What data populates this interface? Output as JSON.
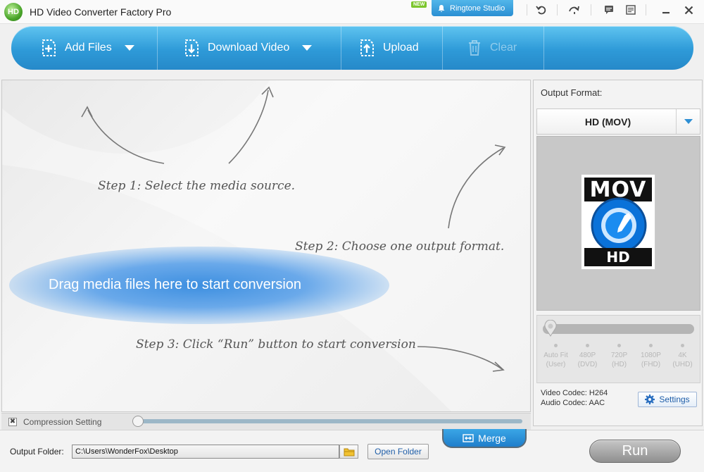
{
  "titlebar": {
    "logo_text": "HD",
    "title": "HD Video Converter Factory Pro",
    "new_badge": "NEW",
    "ringtone_label": "Ringtone Studio",
    "icons": [
      "undo-icon",
      "refresh-icon",
      "chat-icon",
      "list-icon",
      "minimize-icon",
      "close-icon"
    ]
  },
  "toolbar": {
    "add_files": "Add Files",
    "download_video": "Download Video",
    "upload": "Upload",
    "clear": "Clear"
  },
  "main": {
    "step1": "Step 1: Select the media source.",
    "step2": "Step 2: Choose one output format.",
    "step3": "Step 3: Click “Run” button to start conversion",
    "drag_text": "Drag media files here to start conversion"
  },
  "output_panel": {
    "label": "Output Format:",
    "format": "HD (MOV)",
    "preview_top": "MOV",
    "preview_bottom": "HD",
    "quality_marks": [
      {
        "line1": "Auto Fit",
        "line2": "(User)"
      },
      {
        "line1": "480P",
        "line2": "(DVD)"
      },
      {
        "line1": "720P",
        "line2": "(HD)"
      },
      {
        "line1": "1080P",
        "line2": "(FHD)"
      },
      {
        "line1": "4K",
        "line2": "(UHD)"
      }
    ],
    "video_codec": "Video Codec: H264",
    "audio_codec": "Audio Codec: AAC",
    "settings_label": "Settings"
  },
  "compression": {
    "label": "Compression Setting",
    "checked_mark": "✖"
  },
  "bottom": {
    "merge_label": "Merge",
    "output_folder_label": "Output Folder:",
    "output_folder_value": "C:\\Users\\WonderFox\\Desktop",
    "open_folder_label": "Open Folder",
    "run_label": "Run"
  },
  "colors": {
    "toolbar_blue": "#2e9ad8",
    "accent_blue": "#1f7ecb",
    "run_gray": "#8f8f8f"
  }
}
